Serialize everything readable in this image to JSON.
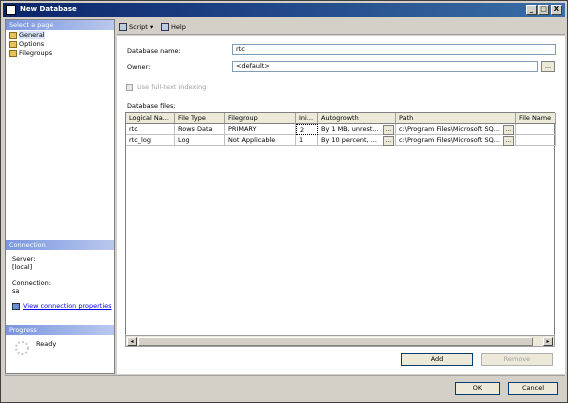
{
  "window": {
    "title": "New Database",
    "minimize": "_",
    "maximize": "□",
    "close": "X"
  },
  "left_pane": {
    "select_page_header": "Select a page",
    "pages": [
      "General",
      "Options",
      "Filegroups"
    ],
    "connection_header": "Connection",
    "server_label": "Server:",
    "server_value": "[local]",
    "connection_label": "Connection:",
    "connection_value": "sa",
    "view_connection_link": "View connection properties",
    "progress_header": "Progress",
    "progress_status": "Ready"
  },
  "toolbar": {
    "script_label": "Script",
    "script_arrow": "▾",
    "help_label": "Help"
  },
  "form": {
    "database_name_label": "Database name:",
    "database_name_value": "rtc",
    "owner_label": "Owner:",
    "owner_value": "<default>",
    "ellipsis": "...",
    "fulltext_label": "Use full-text indexing",
    "database_files_label": "Database files:"
  },
  "grid": {
    "columns": [
      "Logical Na...",
      "File Type",
      "Filegroup",
      "Ini...",
      "Autogrowth",
      "Path",
      "File Name"
    ],
    "rows": [
      [
        "rtc",
        "Rows Data",
        "PRIMARY",
        "2",
        "By 1 MB, unrest...",
        "c:\\Program Files\\Microsoft SQ...",
        ""
      ],
      [
        "rtc_log",
        "Log",
        "Not Applicable",
        "1",
        "By 10 percent, ...",
        "c:\\Program Files\\Microsoft SQ...",
        ""
      ]
    ]
  },
  "buttons": {
    "add": "Add",
    "remove": "Remove",
    "ok": "OK",
    "cancel": "Cancel"
  },
  "scroll": {
    "left": "◂",
    "right": "▸"
  }
}
